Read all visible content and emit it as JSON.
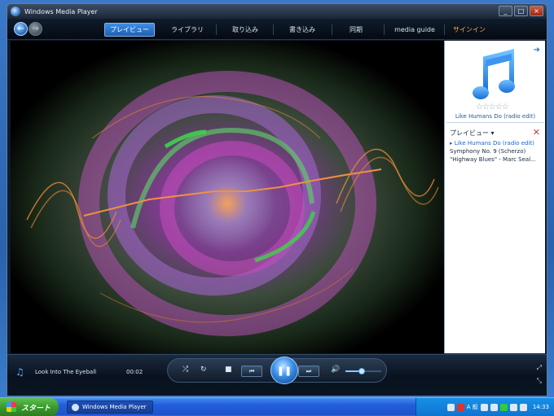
{
  "window": {
    "title": "Windows Media Player",
    "controls": {
      "minimize": "_",
      "maximize": "□",
      "close": "×"
    }
  },
  "nav": {
    "back_icon": "back-arrow-icon",
    "forward_icon": "forward-arrow-icon",
    "tabs": [
      {
        "label": "プレイビュー",
        "active": true
      },
      {
        "label": "ライブラリ",
        "active": false
      },
      {
        "label": "取り込み",
        "active": false
      },
      {
        "label": "書き込み",
        "active": false
      },
      {
        "label": "同期",
        "active": false
      },
      {
        "label": "media guide",
        "active": false
      },
      {
        "label": "サインイン",
        "active": false
      }
    ]
  },
  "right_pane": {
    "album_icon": "music-note-icon",
    "stars": "☆☆☆☆☆",
    "album_title": "Like Humans Do (radio edit)",
    "list_header": "プレイビュー ▾",
    "list_close": "✕",
    "playlist": [
      {
        "label": "▸ Like Humans Do (radio edit)",
        "current": true
      },
      {
        "label": "Symphony No. 9 (Scherzo)",
        "current": false
      },
      {
        "label": "\"Highway Blues\" - Marc Seal...",
        "current": false
      }
    ]
  },
  "transport": {
    "now_playing_icon": "music-note-icon",
    "track_name": "Look Into The Eyeball",
    "time": "00:02",
    "seek_progress": 0.06,
    "buttons": {
      "shuffle": "⤮",
      "repeat": "↻",
      "stop": "■",
      "prev": "⏮",
      "play_pause": "❚❚",
      "next": "⏭",
      "mute": "🔊"
    },
    "volume": 0.45
  },
  "taskbar": {
    "start_label": "スタート",
    "task_label": "Windows Media Player",
    "tray_ime": "A 般",
    "clock": "14:33"
  }
}
